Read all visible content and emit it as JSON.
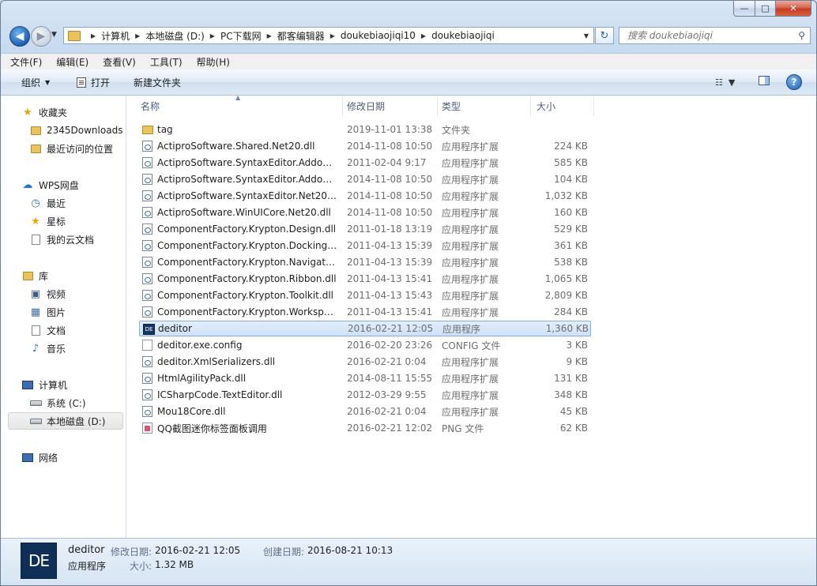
{
  "window": {
    "caption": {
      "minimize": "—",
      "maximize": "□",
      "close": "✕"
    }
  },
  "nav": {
    "back": "◀",
    "forward": "▶",
    "history": "▼",
    "breadcrumbs": [
      "计算机",
      "本地磁盘 (D:)",
      "PC下载网",
      "都客编辑器",
      "doukebiaojiqi10",
      "doukebiaojiqi"
    ],
    "refresh": "↻",
    "search_placeholder": "搜索 doukebiaojiqi",
    "search_icon": "⚲"
  },
  "menu": [
    "文件(F)",
    "编辑(E)",
    "查看(V)",
    "工具(T)",
    "帮助(H)"
  ],
  "toolbar": {
    "organize": "组织",
    "open": "打开",
    "new_folder": "新建文件夹",
    "help": "?"
  },
  "sidebar": [
    {
      "label": "收藏夹",
      "icon": "star-icon",
      "glyph": "★",
      "color": "#e8a40c"
    },
    {
      "label": "2345Downloads",
      "icon": "folder-icon",
      "glyph": ""
    },
    {
      "label": "最近访问的位置",
      "icon": "recent-places-icon",
      "glyph": ""
    },
    {
      "label": "WPS网盘",
      "icon": "cloud-icon",
      "glyph": "☁",
      "color": "#2a78c8"
    },
    {
      "label": "最近",
      "icon": "clock-icon",
      "glyph": "◷",
      "color": "#2a78c8"
    },
    {
      "label": "星标",
      "icon": "star-icon",
      "glyph": "★",
      "color": "#e8a40c"
    },
    {
      "label": "我的云文档",
      "icon": "document-icon",
      "glyph": ""
    },
    {
      "label": "库",
      "icon": "library-icon",
      "glyph": ""
    },
    {
      "label": "视频",
      "icon": "video-icon",
      "glyph": "▣",
      "color": "#3a5a80"
    },
    {
      "label": "图片",
      "icon": "picture-icon",
      "glyph": "▦",
      "color": "#3a6ea0"
    },
    {
      "label": "文档",
      "icon": "document-icon",
      "glyph": ""
    },
    {
      "label": "音乐",
      "icon": "music-icon",
      "glyph": "♪",
      "color": "#2a6cc0"
    },
    {
      "label": "计算机",
      "icon": "computer-icon",
      "glyph": ""
    },
    {
      "label": "系统 (C:)",
      "icon": "drive-icon",
      "glyph": ""
    },
    {
      "label": "本地磁盘 (D:)",
      "icon": "drive-icon",
      "glyph": ""
    },
    {
      "label": "网络",
      "icon": "network-icon",
      "glyph": ""
    }
  ],
  "columns": [
    "名称",
    "修改日期",
    "类型",
    "大小"
  ],
  "files": [
    {
      "name": "tag",
      "date": "2019-11-01 13:38",
      "type": "文件夹",
      "size": "",
      "icon": "folder-icon"
    },
    {
      "name": "ActiproSoftware.Shared.Net20.dll",
      "date": "2014-11-08 10:50",
      "type": "应用程序扩展",
      "size": "224 KB",
      "icon": "dll-icon"
    },
    {
      "name": "ActiproSoftware.SyntaxEditor.Addons....",
      "date": "2011-02-04 9:17",
      "type": "应用程序扩展",
      "size": "585 KB",
      "icon": "dll-icon"
    },
    {
      "name": "ActiproSoftware.SyntaxEditor.Addons....",
      "date": "2014-11-08 10:50",
      "type": "应用程序扩展",
      "size": "104 KB",
      "icon": "dll-icon"
    },
    {
      "name": "ActiproSoftware.SyntaxEditor.Net20.dll",
      "date": "2014-11-08 10:50",
      "type": "应用程序扩展",
      "size": "1,032 KB",
      "icon": "dll-icon"
    },
    {
      "name": "ActiproSoftware.WinUICore.Net20.dll",
      "date": "2014-11-08 10:50",
      "type": "应用程序扩展",
      "size": "160 KB",
      "icon": "dll-icon"
    },
    {
      "name": "ComponentFactory.Krypton.Design.dll",
      "date": "2011-01-18 13:19",
      "type": "应用程序扩展",
      "size": "529 KB",
      "icon": "dll-icon"
    },
    {
      "name": "ComponentFactory.Krypton.Docking....",
      "date": "2011-04-13 15:39",
      "type": "应用程序扩展",
      "size": "361 KB",
      "icon": "dll-icon"
    },
    {
      "name": "ComponentFactory.Krypton.Navigato....",
      "date": "2011-04-13 15:39",
      "type": "应用程序扩展",
      "size": "538 KB",
      "icon": "dll-icon"
    },
    {
      "name": "ComponentFactory.Krypton.Ribbon.dll",
      "date": "2011-04-13 15:41",
      "type": "应用程序扩展",
      "size": "1,065 KB",
      "icon": "dll-icon"
    },
    {
      "name": "ComponentFactory.Krypton.Toolkit.dll",
      "date": "2011-04-13 15:43",
      "type": "应用程序扩展",
      "size": "2,809 KB",
      "icon": "dll-icon"
    },
    {
      "name": "ComponentFactory.Krypton.Workspa...",
      "date": "2011-04-13 15:41",
      "type": "应用程序扩展",
      "size": "284 KB",
      "icon": "dll-icon"
    },
    {
      "name": "deditor",
      "date": "2016-02-21 12:05",
      "type": "应用程序",
      "size": "1,360 KB",
      "icon": "exe-icon",
      "selected": true
    },
    {
      "name": "deditor.exe.config",
      "date": "2016-02-20 23:26",
      "type": "CONFIG 文件",
      "size": "3 KB",
      "icon": "config-icon"
    },
    {
      "name": "deditor.XmlSerializers.dll",
      "date": "2016-02-21 0:04",
      "type": "应用程序扩展",
      "size": "9 KB",
      "icon": "dll-icon"
    },
    {
      "name": "HtmlAgilityPack.dll",
      "date": "2014-08-11 15:55",
      "type": "应用程序扩展",
      "size": "131 KB",
      "icon": "dll-icon"
    },
    {
      "name": "ICSharpCode.TextEditor.dll",
      "date": "2012-03-29 9:55",
      "type": "应用程序扩展",
      "size": "348 KB",
      "icon": "dll-icon"
    },
    {
      "name": "Mou18Core.dll",
      "date": "2016-02-21 0:04",
      "type": "应用程序扩展",
      "size": "45 KB",
      "icon": "dll-icon"
    },
    {
      "name": "QQ截图迷你标签面板调用",
      "date": "2016-02-21 12:02",
      "type": "PNG 文件",
      "size": "62 KB",
      "icon": "png-icon"
    }
  ],
  "details": {
    "icon_text": "DE",
    "name": "deditor",
    "type": "应用程序",
    "modified_label": "修改日期:",
    "modified": "2016-02-21 12:05",
    "created_label": "创建日期:",
    "created": "2016-08-21 10:13",
    "size_label": "大小:",
    "size": "1.32 MB"
  }
}
